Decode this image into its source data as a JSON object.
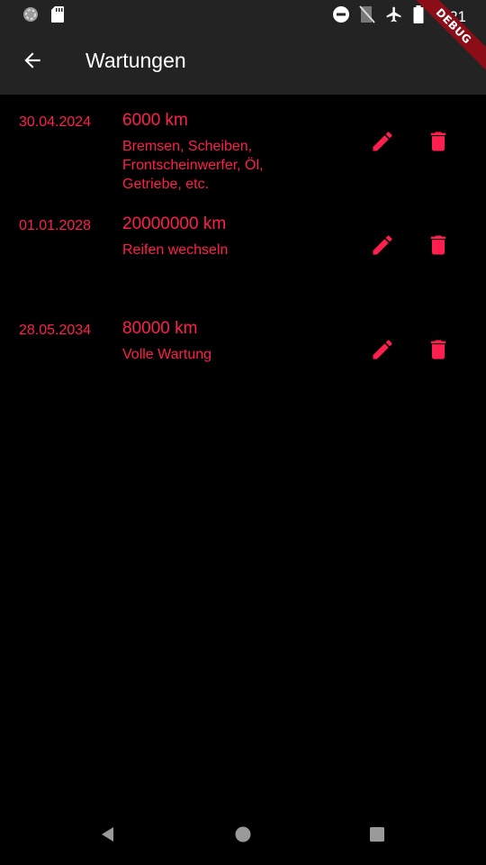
{
  "status_bar": {
    "time": "8:21",
    "icons": [
      "loading-icon",
      "sd-card-icon",
      "do-not-disturb-icon",
      "no-sim-icon",
      "airplane-icon",
      "battery-icon"
    ]
  },
  "app_bar": {
    "title": "Wartungen",
    "back_icon": "arrow-back-icon"
  },
  "debug_banner": "DEBUG",
  "maintenances": [
    {
      "date": "30.04.2024",
      "km": "6000 km",
      "description": "Bremsen, Scheiben, Frontscheinwerfer, Öl, Getriebe, etc."
    },
    {
      "date": "01.01.2028",
      "km": "20000000 km",
      "description": "Reifen wechseln"
    },
    {
      "date": "28.05.2034",
      "km": "80000 km",
      "description": "Volle Wartung"
    }
  ],
  "colors": {
    "accent": "#ff1f4f",
    "app_bar": "#232323",
    "background": "#000000",
    "debug_ribbon": "#8b0d17"
  },
  "nav_bar": {
    "icons": [
      "nav-back-icon",
      "nav-home-icon",
      "nav-recents-icon"
    ]
  }
}
